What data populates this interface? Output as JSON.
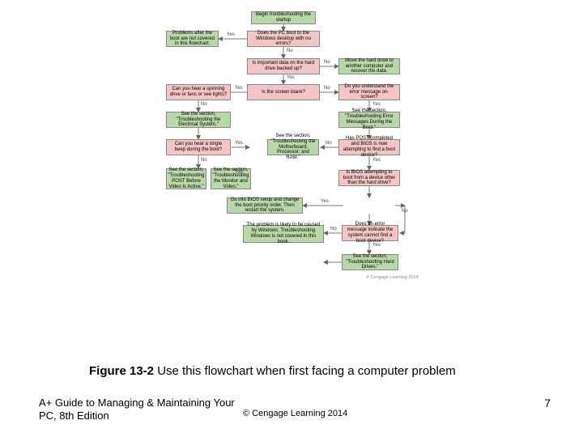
{
  "flow": {
    "n1": "Begin troubleshooting the startup",
    "n2": "Does the PC boot to the Windows desktop with no errors?",
    "n3": "Problems after the boot are not covered in this flowchart.",
    "n4": "Is important data on the hard drive backed up?",
    "n5": "Move the hard drive to another computer and recover the data.",
    "n6": "Is the screen blank?",
    "n7": "Can you hear a spinning drive or fans or see lights?",
    "n8": "Do you understand the error message on-screen?",
    "n9": "See the section, \"Troubleshooting the Electrical System.\"",
    "n10": "See the section, \"Troubleshooting Error Messages During the Boot.\"",
    "n11": "Can you hear a single beep during the boot?",
    "n12": "Has POST completed and BIOS is now attempting to find a boot device?",
    "n13": "See the section, \"Troubleshooting POST Before Video Is Active.\"",
    "n14": "See the section, \"Troubleshooting the Monitor and Video.\"",
    "n15": "See the section, \"Troubleshooting the Motherboard, Processor, and RAM.\"",
    "n16": "Is BIOS attempting to boot from a device other than the hard drive?",
    "n17": "Go into BIOS setup and change the boot priority order. Then restart the system.",
    "n18": "Does an error message indicate the system cannot find a boot device?",
    "n19": "The problem is likely to be caused by Windows. Troubleshooting Windows is not covered in this book.",
    "n20": "See the section, \"Troubleshooting Hard Drives.\"",
    "yes": "Yes",
    "no": "No",
    "credit": "© Cengage Learning 2014"
  },
  "caption": {
    "fig": "Figure 13-2",
    "text": "  Use this flowchart when first facing a computer problem"
  },
  "footer": {
    "book1": "A+ Guide to Managing & Maintaining Your",
    "book2": "PC, 8th Edition",
    "copy": "© Cengage Learning 2014",
    "page": "7"
  }
}
